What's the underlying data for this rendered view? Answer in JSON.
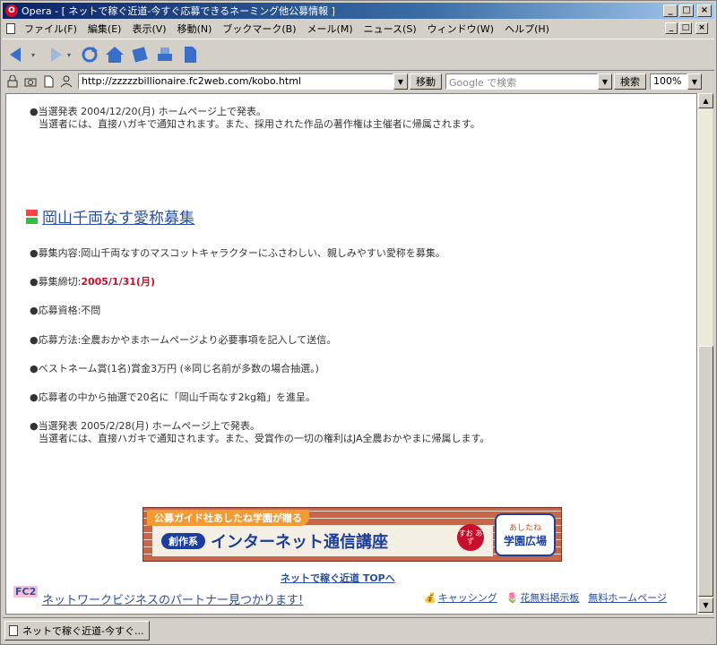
{
  "window": {
    "app_icon": "opera-icon",
    "title": "Opera - [ ネットで稼ぐ近道-今すぐ応募できるネーミング他公募情報 ]",
    "minimize": "_",
    "maximize": "□",
    "close": "×"
  },
  "menu": {
    "items": [
      "ファイル(F)",
      "編集(E)",
      "表示(V)",
      "移動(N)",
      "ブックマーク(B)",
      "メール(M)",
      "ニュース(S)",
      "ウィンドウ(W)",
      "ヘルプ(H)"
    ]
  },
  "toolbar": {
    "buttons": [
      "back-icon",
      "forward-icon",
      "reload-icon",
      "home-icon",
      "hotlist-icon",
      "print-icon",
      "document-icon"
    ]
  },
  "address": {
    "url": "http://zzzzzbillionaire.fc2web.com/kobo.html",
    "go_label": "移動",
    "search_placeholder": "Google で検索",
    "search_label": "検索",
    "zoom": "100%"
  },
  "content": {
    "prev_announce_line1": "●当選発表 2004/12/20(月) ホームページ上で発表。",
    "prev_announce_line2": "当選者には、直接ハガキで通知されます。また、採用された作品の著作権は主催者に帰属されます。",
    "section_title": "岡山千両なす愛称募集",
    "item_content": "●募集内容:岡山千両なすのマスコットキャラクターにふさわしい、親しみやすい愛称を募集。",
    "deadline_label": "●募集締切:",
    "deadline_value": "2005/1/31(月)",
    "item_eligibility": "●応募資格:不問",
    "item_method": "●応募方法:全農おかやまホームページより必要事項を記入して送信。",
    "item_prize": "●ベストネーム賞(1名)賞金3万円 (※同じ名前が多数の場合抽選。)",
    "item_lottery": "●応募者の中から抽選で20名に「岡山千両なす2kg箱」を進呈。",
    "announce_line1": "●当選発表 2005/2/28(月) ホームページ上で発表。",
    "announce_line2": "当選者には、直接ハガキで通知されます。また、受賞作の一切の権利はJA全農おかやまに帰属します。"
  },
  "banner": {
    "top_text": "公募ガイド社あしたね学園が贈る",
    "pill": "創作系",
    "course": "インターネット通信講座",
    "badge": "すお あず",
    "logo_small": "あしたね",
    "logo_big": "学園広場"
  },
  "footer": {
    "top_link": "ネットで稼ぐ近道 TOPへ",
    "fc2": "FC2",
    "network_link": "ネットワークビジネスのパートナー見つかります!",
    "caching": "キャッシング",
    "flower_board": "花無料掲示板",
    "free_homepage": "無料ホームページ"
  },
  "tabs": [
    {
      "label": "ネットで稼ぐ近道-今すぐ..."
    }
  ]
}
